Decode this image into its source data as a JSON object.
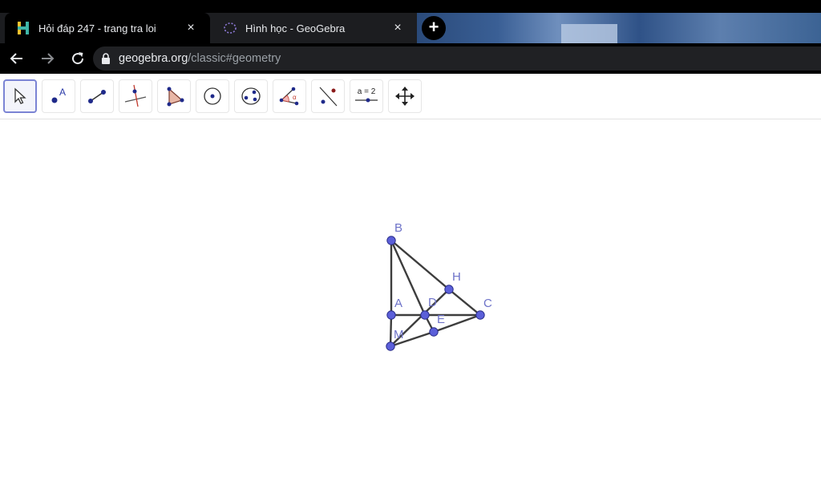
{
  "browser": {
    "tabs": [
      {
        "title": "Hỏi đáp 247 - trang tra loi",
        "favicon": "h-logo-icon",
        "active": true
      },
      {
        "title": "Hình học - GeoGebra",
        "favicon": "geogebra-icon",
        "active": false
      }
    ],
    "new_tab_label": "+",
    "close_glyph": "×",
    "url_host": "geogebra.org",
    "url_path": "/classic#geometry"
  },
  "toolbar": {
    "tools": [
      {
        "name": "move-tool",
        "icon": "cursor-arrow-icon"
      },
      {
        "name": "point-tool",
        "icon": "point-icon",
        "label": "A"
      },
      {
        "name": "segment-tool",
        "icon": "segment-icon"
      },
      {
        "name": "perpendicular-line-tool",
        "icon": "perpendicular-icon"
      },
      {
        "name": "polygon-tool",
        "icon": "polygon-icon"
      },
      {
        "name": "circle-center-point-tool",
        "icon": "circle-center-icon"
      },
      {
        "name": "circle-three-points-tool",
        "icon": "circle-three-points-icon"
      },
      {
        "name": "angle-tool",
        "icon": "angle-icon",
        "label": "α"
      },
      {
        "name": "reflect-tool",
        "icon": "reflect-icon"
      },
      {
        "name": "slider-tool",
        "icon": "slider-icon",
        "label": "a = 2"
      },
      {
        "name": "move-graphics-view-tool",
        "icon": "move-arrows-icon"
      }
    ]
  },
  "geometry": {
    "points": [
      "B",
      "H",
      "A",
      "D",
      "C",
      "E",
      "M"
    ],
    "colors": {
      "point_fill": "#5b5fd9",
      "point_stroke": "#2b2e8a",
      "segment": "#3d3d3d",
      "label": "#6d72c8"
    }
  }
}
